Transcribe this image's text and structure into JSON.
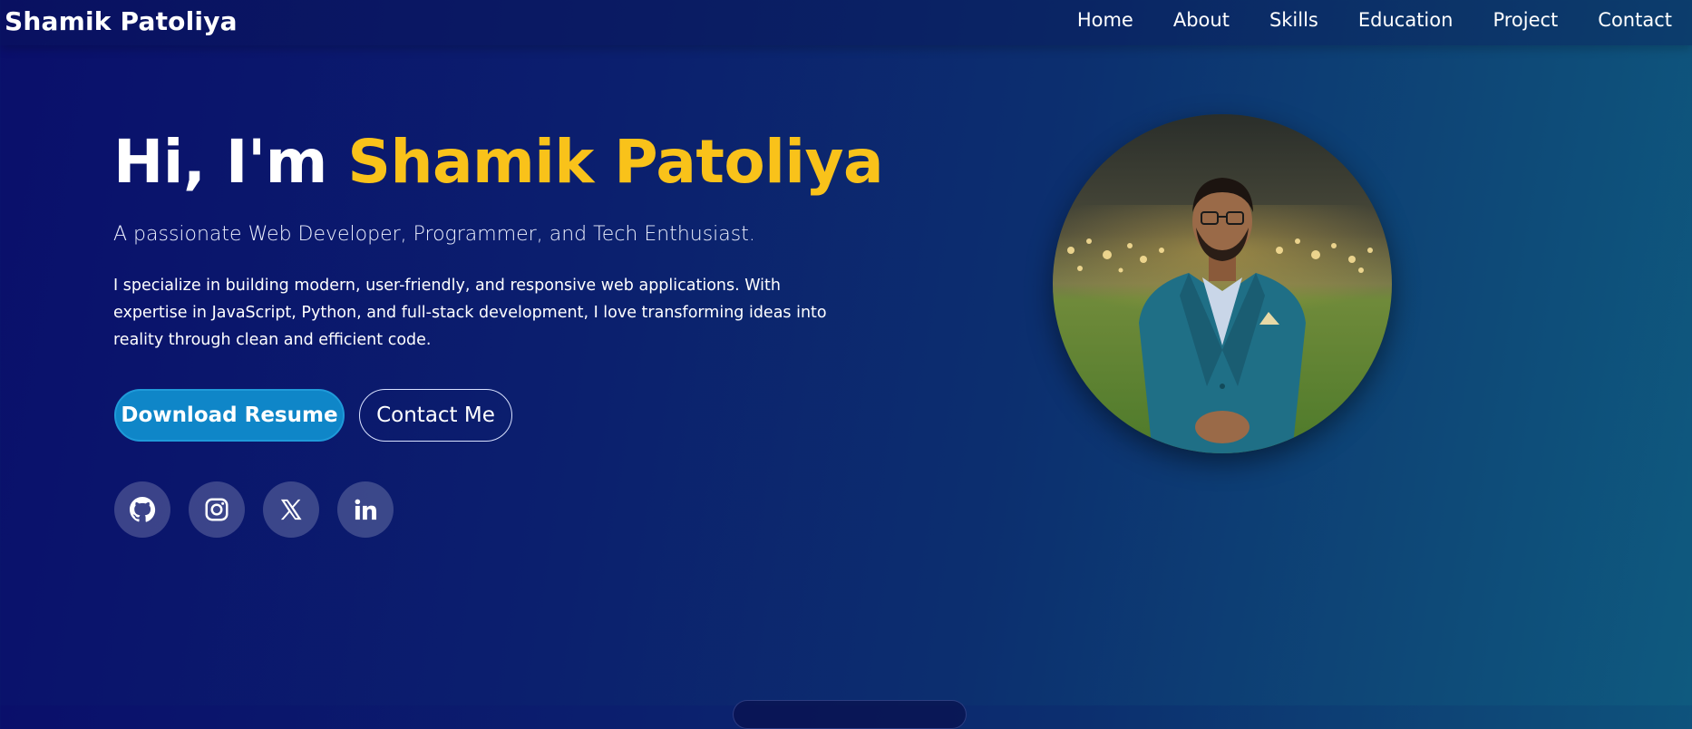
{
  "nav": {
    "brand": "Shamik Patoliya",
    "links": [
      "Home",
      "About",
      "Skills",
      "Education",
      "Project",
      "Contact"
    ]
  },
  "hero": {
    "greeting": "Hi, I'm ",
    "name": "Shamik Patoliya",
    "tagline": "A passionate Web Developer, Programmer, and Tech Enthusiast.",
    "description": "I specialize in building modern, user-friendly, and responsive web applications. With expertise in JavaScript, Python, and full-stack development, I love transforming ideas into reality through clean and efficient code.",
    "primary_button": "Download Resume",
    "secondary_button": "Contact Me"
  },
  "socials": [
    {
      "icon": "github-icon"
    },
    {
      "icon": "instagram-icon"
    },
    {
      "icon": "x-icon"
    },
    {
      "icon": "linkedin-icon"
    }
  ],
  "colors": {
    "accent": "#f9c21a",
    "primary_button": "#0f86c8",
    "background_start": "#0a0f6b",
    "background_end": "#0f5a7f"
  }
}
